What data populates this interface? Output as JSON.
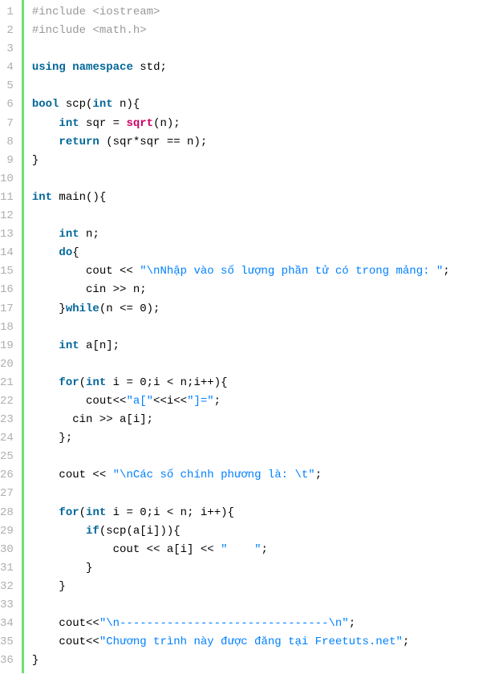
{
  "lineCount": 36,
  "lines": [
    [
      [
        "pp",
        "#include <iostream>"
      ]
    ],
    [
      [
        "pp",
        "#include <math.h>"
      ]
    ],
    [],
    [
      [
        "kw",
        "using"
      ],
      [
        "plain",
        " "
      ],
      [
        "kw",
        "namespace"
      ],
      [
        "plain",
        " std;"
      ]
    ],
    [],
    [
      [
        "kw",
        "bool"
      ],
      [
        "plain",
        " scp("
      ],
      [
        "kw",
        "int"
      ],
      [
        "plain",
        " n){"
      ]
    ],
    [
      [
        "plain",
        "    "
      ],
      [
        "kw",
        "int"
      ],
      [
        "plain",
        " sqr = "
      ],
      [
        "fn",
        "sqrt"
      ],
      [
        "plain",
        "(n);"
      ]
    ],
    [
      [
        "plain",
        "    "
      ],
      [
        "kw",
        "return"
      ],
      [
        "plain",
        " (sqr*sqr == n);"
      ]
    ],
    [
      [
        "plain",
        "}"
      ]
    ],
    [],
    [
      [
        "kw",
        "int"
      ],
      [
        "plain",
        " main(){"
      ]
    ],
    [],
    [
      [
        "plain",
        "    "
      ],
      [
        "kw",
        "int"
      ],
      [
        "plain",
        " n;"
      ]
    ],
    [
      [
        "plain",
        "    "
      ],
      [
        "kw",
        "do"
      ],
      [
        "plain",
        "{"
      ]
    ],
    [
      [
        "plain",
        "        cout << "
      ],
      [
        "str",
        "\"\\nNhập vào số lượng phần tử có trong mảng: \""
      ],
      [
        "plain",
        ";"
      ]
    ],
    [
      [
        "plain",
        "        cin >> n;"
      ]
    ],
    [
      [
        "plain",
        "    }"
      ],
      [
        "kw",
        "while"
      ],
      [
        "plain",
        "(n <= 0);"
      ]
    ],
    [],
    [
      [
        "plain",
        "    "
      ],
      [
        "kw",
        "int"
      ],
      [
        "plain",
        " a[n];"
      ]
    ],
    [],
    [
      [
        "plain",
        "    "
      ],
      [
        "kw",
        "for"
      ],
      [
        "plain",
        "("
      ],
      [
        "kw",
        "int"
      ],
      [
        "plain",
        " i = 0;i < n;i++){"
      ]
    ],
    [
      [
        "plain",
        "        cout<<"
      ],
      [
        "str",
        "\"a[\""
      ],
      [
        "plain",
        "<<i<<"
      ],
      [
        "str",
        "\"]=\""
      ],
      [
        "plain",
        ";"
      ]
    ],
    [
      [
        "plain",
        "      cin >> a[i];"
      ]
    ],
    [
      [
        "plain",
        "    };"
      ]
    ],
    [],
    [
      [
        "plain",
        "    cout << "
      ],
      [
        "str",
        "\"\\nCác số chính phương là: \\t\""
      ],
      [
        "plain",
        ";"
      ]
    ],
    [],
    [
      [
        "plain",
        "    "
      ],
      [
        "kw",
        "for"
      ],
      [
        "plain",
        "("
      ],
      [
        "kw",
        "int"
      ],
      [
        "plain",
        " i = 0;i < n; i++){"
      ]
    ],
    [
      [
        "plain",
        "        "
      ],
      [
        "kw",
        "if"
      ],
      [
        "plain",
        "(scp(a[i])){"
      ]
    ],
    [
      [
        "plain",
        "            cout << a[i] << "
      ],
      [
        "str",
        "\"    \""
      ],
      [
        "plain",
        ";"
      ]
    ],
    [
      [
        "plain",
        "        }"
      ]
    ],
    [
      [
        "plain",
        "    }"
      ]
    ],
    [],
    [
      [
        "plain",
        "    cout<<"
      ],
      [
        "str",
        "\"\\n-------------------------------\\n\""
      ],
      [
        "plain",
        ";"
      ]
    ],
    [
      [
        "plain",
        "    cout<<"
      ],
      [
        "str",
        "\"Chương trình này được đăng tại Freetuts.net\""
      ],
      [
        "plain",
        ";"
      ]
    ],
    [
      [
        "plain",
        "}"
      ]
    ]
  ]
}
